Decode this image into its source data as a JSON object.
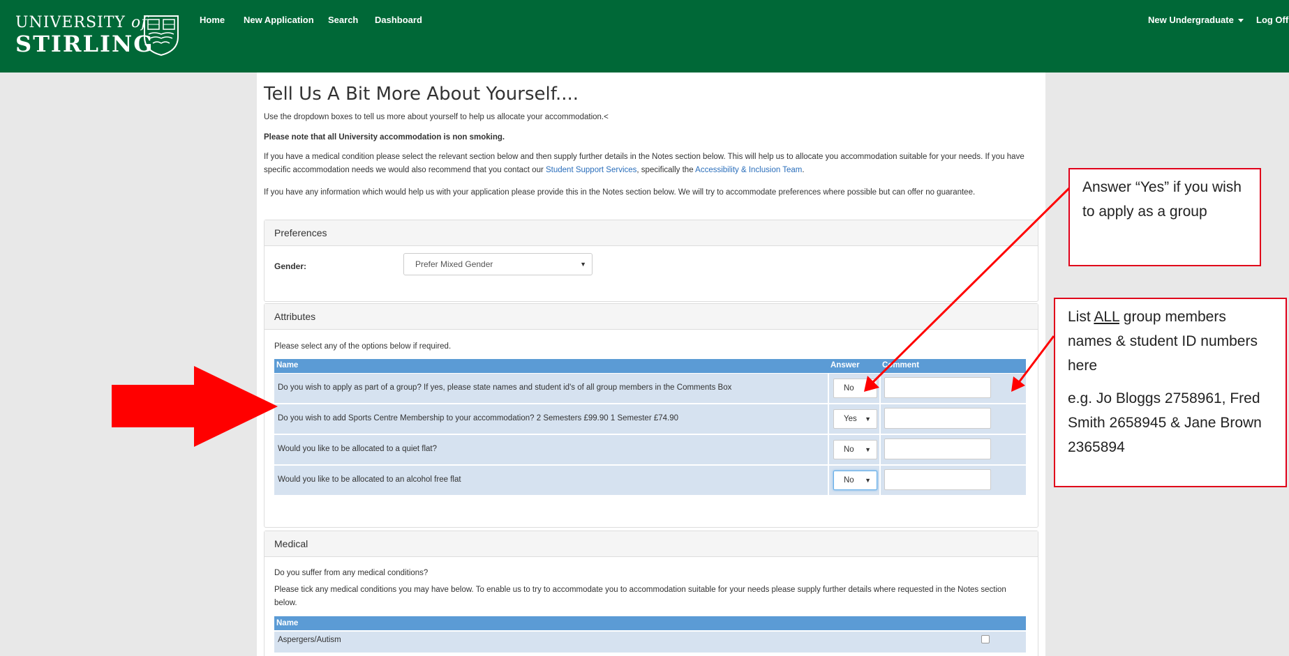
{
  "header": {
    "logo_line1_a": "UNIVERSITY",
    "logo_line1_b": "of",
    "logo_line2": "STIRLING",
    "crest_icon": "university-crest-icon",
    "nav": {
      "home": "Home",
      "new_application": "New Application",
      "search": "Search",
      "dashboard": "Dashboard",
      "user_menu": "New Undergraduate",
      "log_off": "Log Off"
    },
    "brand_color": "#006837"
  },
  "page": {
    "title": "Tell Us A Bit More About Yourself....",
    "intro": "Use the dropdown boxes to tell us more about yourself to help us allocate your accommodation.<",
    "non_smoking": "Please note that all University accommodation is non smoking.",
    "medical_note_pre": "If you have a medical condition please select the relevant section below and then supply further details in the Notes section below. This will help us to allocate you accommodation suitable for your needs. If you have specific accommodation needs we would also recommend that you contact our ",
    "link_student_support": "Student Support Services",
    "medical_note_mid": ", specifically the ",
    "link_accessibility": "Accessibility & Inclusion Team",
    "medical_note_post": ".",
    "info_note": "If you have any information which would help us with your application please provide this in the Notes section below. We will try to accommodate preferences where possible but can offer no guarantee."
  },
  "preferences": {
    "heading": "Preferences",
    "gender_label": "Gender:",
    "gender_value": "Prefer Mixed Gender"
  },
  "attributes": {
    "heading": "Attributes",
    "instruction": "Please select any of the options below if required.",
    "columns": {
      "name": "Name",
      "answer": "Answer",
      "comment": "Comment"
    },
    "rows": [
      {
        "name": "Do you wish to apply as part of a group? If yes, please state names and student id's of all group members in the Comments Box",
        "answer": "No"
      },
      {
        "name": "Do you wish to add Sports Centre Membership to your accommodation? 2 Semesters £99.90 1 Semester £74.90",
        "answer": "Yes"
      },
      {
        "name": "Would you like to be allocated to a quiet flat?",
        "answer": "No"
      },
      {
        "name": "Would you like to be allocated to an alcohol free flat",
        "answer": "No"
      }
    ]
  },
  "medical": {
    "heading": "Medical",
    "question": "Do you suffer from any medical conditions?",
    "instruction": "Please tick any medical conditions you may have below.  To enable us to try to accommodate you to accommodation suitable for your needs please supply further details where requested in the Notes section below.",
    "column_name": "Name",
    "rows": [
      {
        "name": "Aspergers/Autism",
        "checked": false
      }
    ]
  },
  "annotations": {
    "group_callout": "Answer “Yes” if you wish to apply as a group",
    "members_callout_pre": "List ",
    "members_callout_u": "ALL",
    "members_callout_post": " group members names & student ID numbers here",
    "members_example": "e.g. Jo Bloggs 2758961, Fred Smith 2658945 & Jane Brown 2365894",
    "accent_color": "#e0001a"
  }
}
